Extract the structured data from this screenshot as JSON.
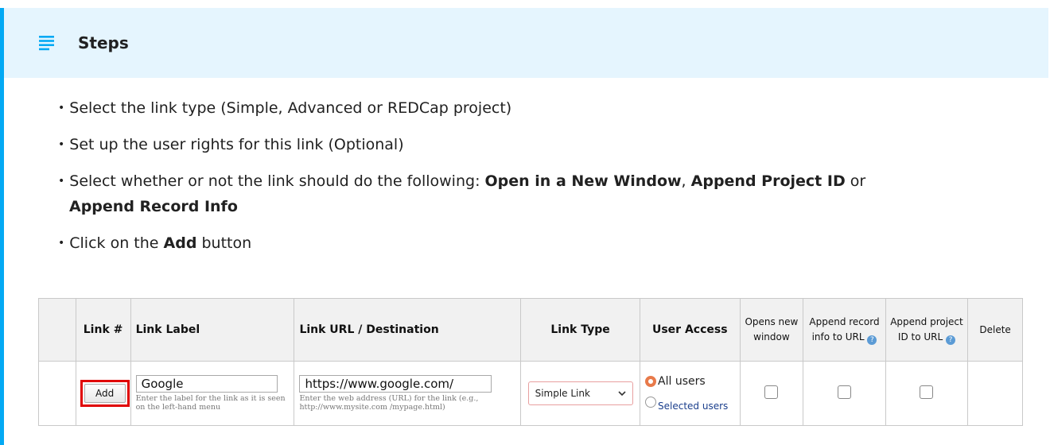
{
  "callout": {
    "title": "Steps",
    "accent": "#03a9f4",
    "header_bg": "#e5f5fe",
    "icon": "list-lines-icon"
  },
  "steps": [
    {
      "text": "Select the link type (Simple, Advanced or REDCap project)"
    },
    {
      "text": "Set up the user rights for this link (Optional)"
    },
    {
      "pre": "Select whether or not the link should do the following: ",
      "b1": "Open in a New Window",
      "mid1": ", ",
      "b2": "Append Project ID",
      "mid2": " or ",
      "b3": "Append Record Info"
    },
    {
      "pre": "Click on the ",
      "b1": "Add",
      "post": " button"
    }
  ],
  "table": {
    "headers": {
      "link_num": "Link #",
      "label": "Link Label",
      "url": "Link URL / Destination",
      "type": "Link Type",
      "access": "User Access",
      "new_window": "Opens new window",
      "append_record": "Append record info to URL",
      "append_project": "Append project ID to URL",
      "delete": "Delete"
    },
    "row": {
      "add_button": "Add",
      "label_value": "Google",
      "label_hint": "Enter the label for the link as it is seen on the left-hand menu",
      "url_value": "https://www.google.com/",
      "url_hint": "Enter the web address (URL) for the link (e.g., http://www.mysite.com /mypage.html)",
      "type_value": "Simple Link",
      "access_all": "All users",
      "access_selected": "Selected users",
      "access_selected_value": "all",
      "new_window_checked": false,
      "append_record_checked": false,
      "append_project_checked": false
    },
    "highlight_color": "#e00000"
  }
}
